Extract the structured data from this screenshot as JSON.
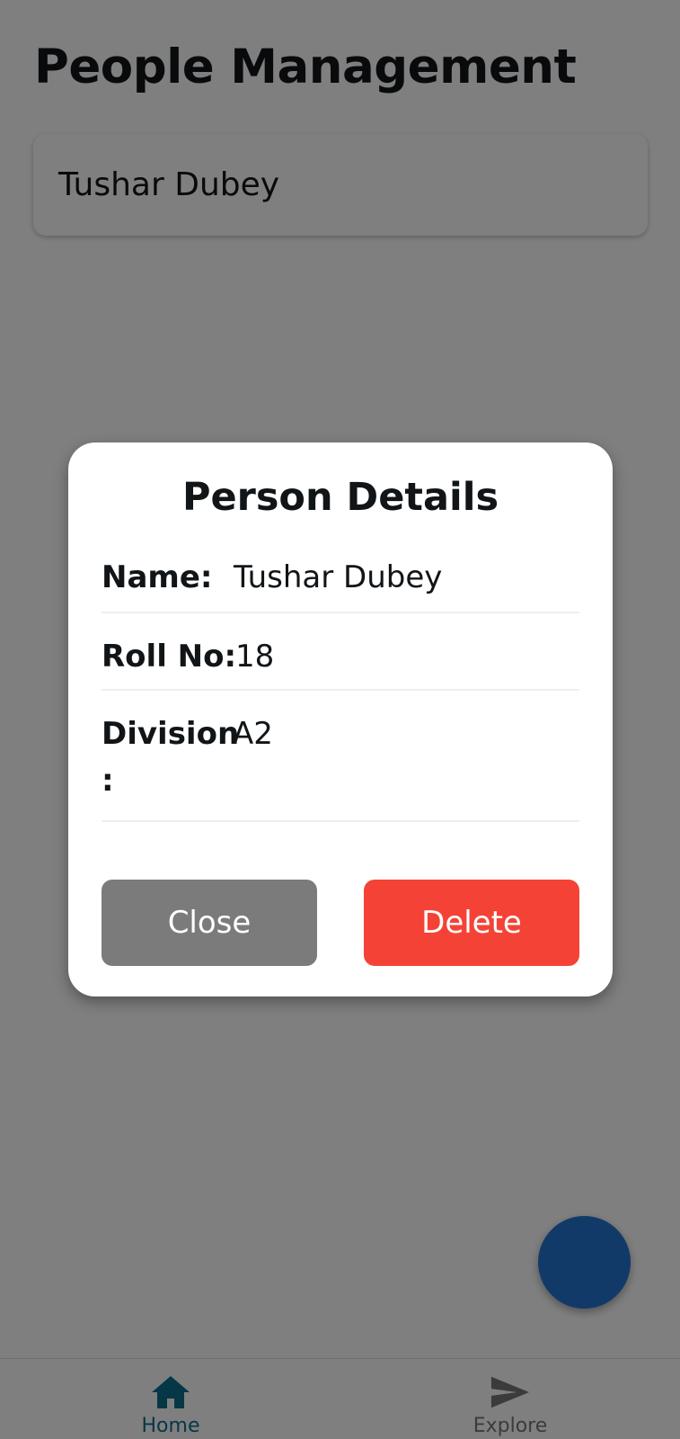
{
  "app": {
    "title": "People Management"
  },
  "people_list": [
    {
      "name": "Tushar Dubey"
    }
  ],
  "dialog": {
    "title": "Person Details",
    "fields": [
      {
        "label": "Name:",
        "value": "Tushar Dubey"
      },
      {
        "label": "Roll No:",
        "value": "18"
      },
      {
        "label_line1": "Division",
        "label_line2": ":",
        "value": "A2"
      }
    ],
    "close_label": "Close",
    "delete_label": "Delete"
  },
  "bottom_nav": {
    "items": [
      {
        "label": "Home",
        "icon": "home-icon",
        "active": true
      },
      {
        "label": "Explore",
        "icon": "send-icon",
        "active": false
      }
    ]
  },
  "colors": {
    "fab": "#2274d1",
    "nav_active": "#0d6e8f",
    "close_button": "#7b7b7b",
    "delete_button": "#f44336"
  }
}
